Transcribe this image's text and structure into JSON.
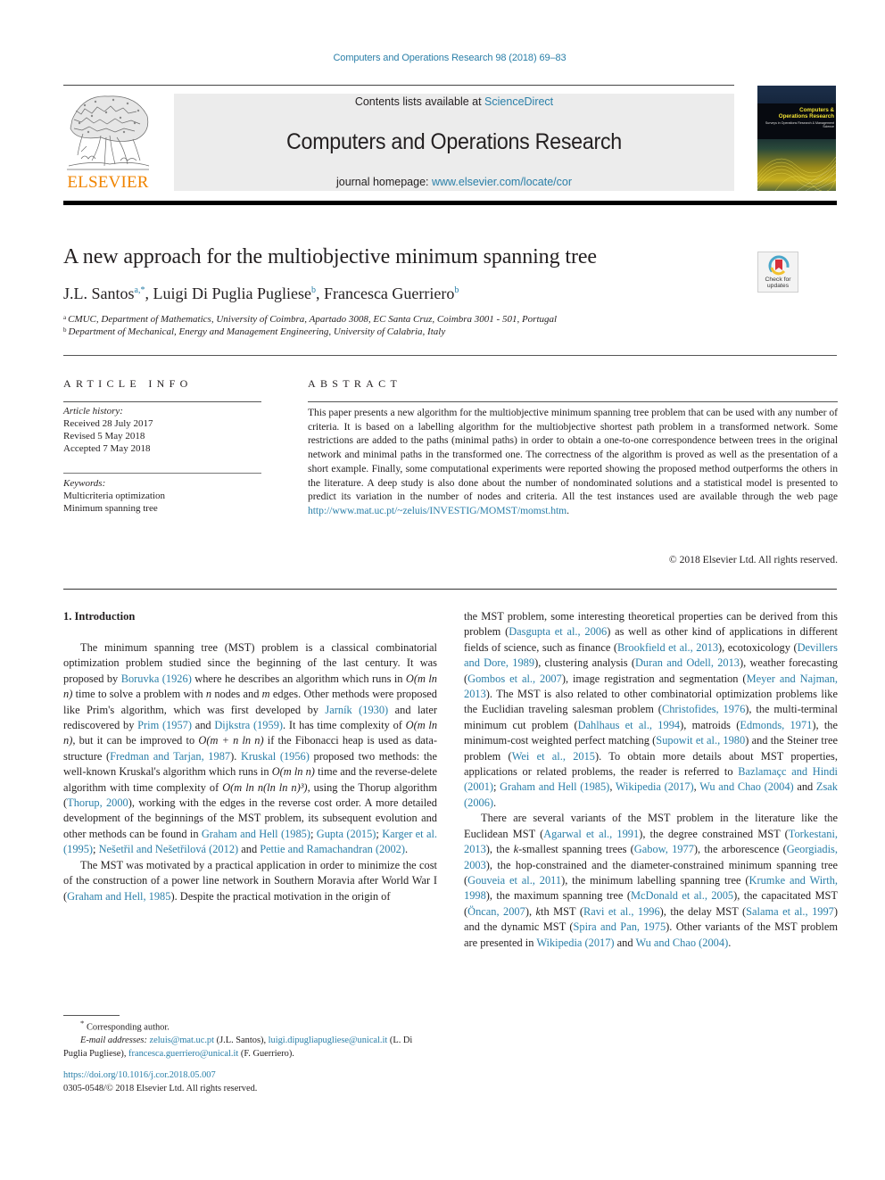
{
  "running_head": "Computers and Operations Research 98 (2018) 69–83",
  "masthead": {
    "publisher": "ELSEVIER",
    "contents_prefix": "Contents lists available at ",
    "contents_link": "ScienceDirect",
    "journal_title": "Computers and Operations Research",
    "homepage_prefix": "journal homepage: ",
    "homepage_link": "www.elsevier.com/locate/cor",
    "cover": {
      "title_line1": "Computers &",
      "title_line2": "Operations Research",
      "subtitle": "Surveys in Operations Research & Management Science"
    }
  },
  "crossmark": {
    "label_line1": "Check for",
    "label_line2": "updates"
  },
  "article": {
    "title": "A new approach for the multiobjective minimum spanning tree",
    "authors": [
      {
        "name": "J.L. Santos",
        "sup": "a,*"
      },
      {
        "name": "Luigi Di Puglia Pugliese",
        "sup": "b"
      },
      {
        "name": "Francesca Guerriero",
        "sup": "b"
      }
    ],
    "affiliations": [
      {
        "mark": "a",
        "text": "CMUC, Department of Mathematics, University of Coimbra, Apartado 3008, EC Santa Cruz, Coimbra 3001 - 501, Portugal"
      },
      {
        "mark": "b",
        "text": "Department of Mechanical, Energy and Management Engineering, University of Calabria, Italy"
      }
    ]
  },
  "article_info": {
    "heading": "ARTICLE INFO",
    "history_label": "Article history:",
    "received": "Received 28 July 2017",
    "revised": "Revised 5 May 2018",
    "accepted": "Accepted 7 May 2018",
    "keywords_label": "Keywords:",
    "keywords": [
      "Multicriteria optimization",
      "Minimum spanning tree"
    ]
  },
  "abstract": {
    "heading": "ABSTRACT",
    "text": "This paper presents a new algorithm for the multiobjective minimum spanning tree problem that can be used with any number of criteria. It is based on a labelling algorithm for the multiobjective shortest path problem in a transformed network. Some restrictions are added to the paths (minimal paths) in order to obtain a one-to-one correspondence between trees in the original network and minimal paths in the transformed one. The correctness of the algorithm is proved as well as the presentation of a short example. Finally, some computational experiments were reported showing the proposed method outperforms the others in the literature. A deep study is also done about the number of nondominated solutions and a statistical model is presented to predict its variation in the number of nodes and criteria. All the test instances used are available through the web page ",
    "link": "http://www.mat.uc.pt/~zeluis/INVESTIG/MOMST/momst.htm",
    "text_end": ".",
    "copyright": "© 2018 Elsevier Ltd. All rights reserved."
  },
  "introduction": {
    "heading": "1. Introduction",
    "p1": [
      {
        "t": "The minimum spanning tree (MST) problem is a classical combinatorial optimization problem studied since the beginning of the last century. It was proposed by "
      },
      {
        "l": "Boruvka (1926)"
      },
      {
        "t": " where he describes an algorithm which runs in "
      },
      {
        "m": "O(m ln n)"
      },
      {
        "t": " time to solve a problem with "
      },
      {
        "m": "n"
      },
      {
        "t": " nodes and "
      },
      {
        "m": "m"
      },
      {
        "t": " edges. Other methods were proposed like Prim's algorithm, which was first developed by "
      },
      {
        "l": "Jarník (1930)"
      },
      {
        "t": " and later rediscovered by "
      },
      {
        "l": "Prim (1957)"
      },
      {
        "t": " and "
      },
      {
        "l": "Dijkstra (1959)"
      },
      {
        "t": ". It has time complexity of "
      },
      {
        "m": "O(m ln n)"
      },
      {
        "t": ", but it can be improved to "
      },
      {
        "m": "O(m + n ln n)"
      },
      {
        "t": " if the Fibonacci heap is used as data-structure ("
      },
      {
        "l": "Fredman and Tarjan, 1987"
      },
      {
        "t": "). "
      },
      {
        "l": "Kruskal (1956)"
      },
      {
        "t": " proposed two methods: the well-known Kruskal's algorithm which runs in "
      },
      {
        "m": "O(m ln n)"
      },
      {
        "t": " time and the reverse-delete algorithm with time complexity of "
      },
      {
        "m": "O(m ln n(ln ln n)³)"
      },
      {
        "t": ", using the Thorup algorithm ("
      },
      {
        "l": "Thorup, 2000"
      },
      {
        "t": "), working with the edges in the reverse cost order. A more detailed development of the beginnings of the MST problem, its subsequent evolution and other methods can be found in "
      },
      {
        "l": "Graham and Hell (1985)"
      },
      {
        "t": "; "
      },
      {
        "l": "Gupta (2015)"
      },
      {
        "t": "; "
      },
      {
        "l": "Karger et al. (1995)"
      },
      {
        "t": "; "
      },
      {
        "l": "Nešetřil and Nešetřilová (2012)"
      },
      {
        "t": " and "
      },
      {
        "l": "Pettie and Ramachandran (2002)"
      },
      {
        "t": "."
      }
    ],
    "p2": [
      {
        "t": "The MST was motivated by a practical application in order to minimize the cost of the construction of a power line network in Southern Moravia after World War I ("
      },
      {
        "l": "Graham and Hell, 1985"
      },
      {
        "t": "). Despite the practical motivation in the origin of the MST problem, some interesting theoretical properties can be derived from this problem ("
      },
      {
        "l": "Dasgupta et al., 2006"
      },
      {
        "t": ") as well as other kind of applications in different fields of science, such as finance ("
      },
      {
        "l": "Brookfield et al., 2013"
      },
      {
        "t": "), ecotoxicology ("
      },
      {
        "l": "Devillers and Dore, 1989"
      },
      {
        "t": "), clustering analysis ("
      },
      {
        "l": "Duran and Odell, 2013"
      },
      {
        "t": "), weather forecasting ("
      },
      {
        "l": "Gombos et al., 2007"
      },
      {
        "t": "), image registration and segmentation ("
      },
      {
        "l": "Meyer and Najman, 2013"
      },
      {
        "t": "). The MST is also related to other combinatorial optimization problems like the Euclidian traveling salesman problem ("
      },
      {
        "l": "Christofides, 1976"
      },
      {
        "t": "), the multi-terminal minimum cut problem ("
      },
      {
        "l": "Dahlhaus et al., 1994"
      },
      {
        "t": "), matroids ("
      },
      {
        "l": "Edmonds, 1971"
      },
      {
        "t": "), the minimum-cost weighted perfect matching ("
      },
      {
        "l": "Supowit et al., 1980"
      },
      {
        "t": ") and the Steiner tree problem ("
      },
      {
        "l": "Wei et al., 2015"
      },
      {
        "t": "). To obtain more details about MST properties, applications or related problems, the reader is referred to "
      },
      {
        "l": "Bazlamaçc and Hindi (2001)"
      },
      {
        "t": "; "
      },
      {
        "l": "Graham and Hell (1985)"
      },
      {
        "t": ", "
      },
      {
        "l": "Wikipedia (2017)"
      },
      {
        "t": ", "
      },
      {
        "l": "Wu and Chao (2004)"
      },
      {
        "t": " and "
      },
      {
        "l": "Zsak (2006)"
      },
      {
        "t": "."
      }
    ],
    "p3": [
      {
        "t": "There are several variants of the MST problem in the literature like the Euclidean MST ("
      },
      {
        "l": "Agarwal et al., 1991"
      },
      {
        "t": "), the degree constrained MST ("
      },
      {
        "l": "Torkestani, 2013"
      },
      {
        "t": "), the "
      },
      {
        "m": "k"
      },
      {
        "t": "-smallest spanning trees ("
      },
      {
        "l": "Gabow, 1977"
      },
      {
        "t": "), the arborescence ("
      },
      {
        "l": "Georgiadis, 2003"
      },
      {
        "t": "), the hop-constrained and the diameter-constrained minimum spanning tree ("
      },
      {
        "l": "Gouveia et al., 2011"
      },
      {
        "t": "), the minimum labelling spanning tree ("
      },
      {
        "l": "Krumke and Wirth, 1998"
      },
      {
        "t": "), the maximum spanning tree ("
      },
      {
        "l": "McDonald et al., 2005"
      },
      {
        "t": "), the capacitated MST ("
      },
      {
        "l": "Öncan, 2007"
      },
      {
        "t": "), "
      },
      {
        "m": "k"
      },
      {
        "t": "th MST ("
      },
      {
        "l": "Ravi et al., 1996"
      },
      {
        "t": "), the delay MST ("
      },
      {
        "l": "Salama et al., 1997"
      },
      {
        "t": ") and the dynamic MST ("
      },
      {
        "l": "Spira and Pan, 1975"
      },
      {
        "t": "). Other variants of the MST problem are presented in "
      },
      {
        "l": "Wikipedia (2017)"
      },
      {
        "t": " and "
      },
      {
        "l": "Wu and Chao (2004)"
      },
      {
        "t": "."
      }
    ]
  },
  "footnote": {
    "star": "*",
    "corresponding": "Corresponding author.",
    "email_label": "E-mail addresses: ",
    "emails": [
      {
        "address": "zeluis@mat.uc.pt",
        "owner": " (J.L. Santos), "
      },
      {
        "address": "luigi.dipugliapugliese@unical.it",
        "owner": " (L. Di Puglia Pugliese), "
      },
      {
        "address": "francesca.guerriero@unical.it",
        "owner": " (F. Guerriero)."
      }
    ]
  },
  "doi": {
    "link": "https://doi.org/10.1016/j.cor.2018.05.007",
    "issn_line": "0305-0548/© 2018 Elsevier Ltd. All rights reserved."
  }
}
